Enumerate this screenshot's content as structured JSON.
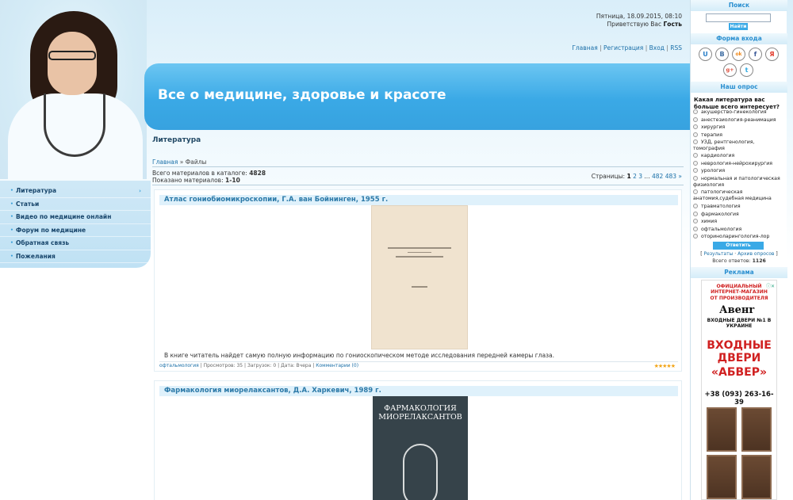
{
  "header": {
    "datetime": "Пятница, 18.09.2015, 08:10",
    "greeting_prefix": "Приветствую Вас",
    "greeting_user": "Гость",
    "links": [
      "Главная",
      "Регистрация",
      "Вход",
      "RSS"
    ],
    "site_title": "Все о медицине, здоровье и красоте"
  },
  "menu": {
    "items": [
      "Литература",
      "Статьи",
      "Видео по медицине онлайн",
      "Форум по медицине",
      "Обратная связь",
      "Пожелания"
    ]
  },
  "content": {
    "section_title": "Литература",
    "breadcrumb": {
      "home": "Главная",
      "sep": "»",
      "current": "Файлы"
    },
    "stats": {
      "total_label": "Всего материалов в каталоге:",
      "total_value": "4828",
      "shown_label": "Показано материалов:",
      "shown_value": "1-10"
    },
    "pages": {
      "label": "Страницы:",
      "items": [
        "1",
        "2",
        "3",
        "...",
        "482",
        "483",
        "»"
      ]
    },
    "entries": [
      {
        "title": "Атлас гониобиомикроскопии, Г.А. ван Бойнинген, 1955 г.",
        "description": "В книге читатель найдет самую полную информацию по гониоскопическом методе исследования передней камеры глаза.",
        "category": "офтальмология",
        "views": "Просмотров: 35",
        "downloads": "Загрузок: 0",
        "date": "Дата: Вчера",
        "comments": "Комментарии (0)"
      },
      {
        "title": "Фармакология миорелаксантов, Д.А. Харкевич, 1989 г.",
        "cover_text": "ФАРМАКОЛОГИЯ МИОРЕЛАКСАНТОВ"
      }
    ]
  },
  "sidebar": {
    "search": {
      "title": "Поиск",
      "button": "Найти"
    },
    "login": {
      "title": "Форма входа",
      "socials": [
        {
          "glyph": "U",
          "color": "#2a7fc8"
        },
        {
          "glyph": "B",
          "color": "#3b6aa0"
        },
        {
          "glyph": "ok",
          "color": "#f08a1c"
        },
        {
          "glyph": "f",
          "color": "#3b5998"
        },
        {
          "glyph": "Я",
          "color": "#e23a2a"
        },
        {
          "glyph": "g+",
          "color": "#dd4b39"
        },
        {
          "glyph": "t",
          "color": "#2fa9e0"
        }
      ]
    },
    "poll": {
      "title": "Наш опрос",
      "question": "Какая литература вас больше всего интересует?",
      "options": [
        "акушерство-гинекология",
        "анестезиология-реанимация",
        "хирургия",
        "терапия",
        "УЗД, рентгенология, томография",
        "кардиология",
        "неврология-нейрохирургия",
        "урология",
        "нормальная и патологическая физиология",
        "патологическая анатомия,судебная медицина",
        "травматология",
        "фармакология",
        "химия",
        "офтальмология",
        "оториноларингология-лор"
      ],
      "vote_button": "Ответить",
      "results_link": "Результаты",
      "archive_link": "Архив опросов",
      "total_label": "Всего ответов:",
      "total_value": "1126"
    },
    "ads": {
      "title": "Реклама",
      "line1": "ОФИЦИАЛЬНЫЙ ИНТЕРНЕТ-МАГАЗИН",
      "line2": "ОТ ПРОИЗВОДИТЕЛЯ",
      "brand": "Авeнr",
      "line3": "ВХОДНЫЕ ДВЕРИ №1 В УКРАИНЕ",
      "headline1": "ВХОДНЫЕ",
      "headline2": "ДВЕРИ",
      "headline3": "«АБВЕР»",
      "phone": "+38 (093) 263-16-39"
    }
  }
}
